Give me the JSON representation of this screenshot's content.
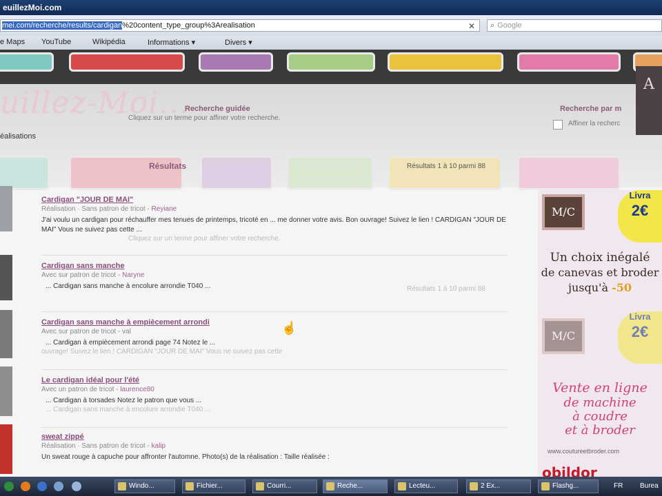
{
  "window": {
    "title": "euillezMoi.com"
  },
  "urlbar": {
    "selected": "mei.com/recherche/results/cardigan",
    "rest": "%20content_type_group%3Arealisation"
  },
  "searchbox": {
    "placeholder": "Google"
  },
  "bookmarks": [
    "e Maps",
    "YouTube",
    "Wikipédia",
    "Informations ▾",
    "Divers ▾"
  ],
  "header": {
    "logo": "uillez-Moi...",
    "search_guided": "Recherche guidée",
    "search_guided_sub": "Cliquez sur un terme pour affiner votre recherche.",
    "search_by": "Recherche par m",
    "refine": "Affiner la recherc",
    "realisations": "éalisations",
    "side_badge": "A"
  },
  "results_header": {
    "label": "Résultats",
    "count": "Résultats 1 à 10 parmi 88"
  },
  "results": [
    {
      "title": "Cardigan \"JOUR DE MAI\"",
      "meta": "Réalisation · Sans patron de tricot -",
      "author": "Reyiane",
      "snippet": "J'ai voulu un cardigan pour réchauffer mes tenues de printemps, tricoté en ... me donner votre avis. Bon ouvrage! Suivez le lien ! CARDIGAN \"JOUR DE MAI\" Vous ne suivez pas cette ...",
      "foot": "Cliquez sur un terme pour affiner votre recherche."
    },
    {
      "title": "Cardigan sans manche",
      "meta": "Avec sur patron de tricot -",
      "author": "Naryne",
      "snippet": "... Cardigan sans manche à encolure arrondie T040 ...",
      "foot": ""
    },
    {
      "title": "Cardigan sans manche à empiècement arrondi",
      "meta": "Avec sur patron de tricot - val",
      "author": "",
      "snippet": "... Cardigan à empiècement arrondi page 74 Notez le ...",
      "foot": "ouvrage! Suivez le lien ! CARDIGAN \"JOUR DE MAI\" Vous ne suivez pas cette"
    },
    {
      "title": "Le cardigan idéal pour l'été",
      "meta": "Avec un patron de tricot -",
      "author": "laurence80",
      "snippet": "... Cardigan à torsades Notez le patron que vous ...",
      "foot": "... Cardigan sans manche à encolure arrondie T040 ..."
    },
    {
      "title": "sweat zippé",
      "meta": "Réalisation · Sans patron de tricot -",
      "author": "kalip",
      "snippet": "Un sweat rouge à capuche pour affronter l'automne. Photo(s) de la réalisation : Taille réalisée :",
      "foot": ""
    }
  ],
  "count_mid": "Résultats 1 à 10 parmi 88",
  "ad": {
    "logo": "M/C",
    "livraison": "Livra",
    "price": "2€",
    "line1": "Un choix inégalé",
    "line2": "de canevas et broder",
    "line3": "jusqu'à",
    "pct": "-50",
    "pink1": "Vente en ligne",
    "pink2": "de machine",
    "pink3": "à coudre",
    "pink4": "et à broder",
    "url": "www.coutureetbroder.com",
    "brand": "obildor"
  },
  "taskbar": {
    "tasks": [
      "Windo...",
      "Fichier...",
      "Courri...",
      "Reche...",
      "Lecteu...",
      "2 Ex...",
      "Flashg..."
    ],
    "tray": [
      "FR",
      "Burea"
    ]
  },
  "colors": {
    "accent": "#8a4d7c",
    "header_bg": "#3a3a3a",
    "taskbar": "#1a2436"
  }
}
